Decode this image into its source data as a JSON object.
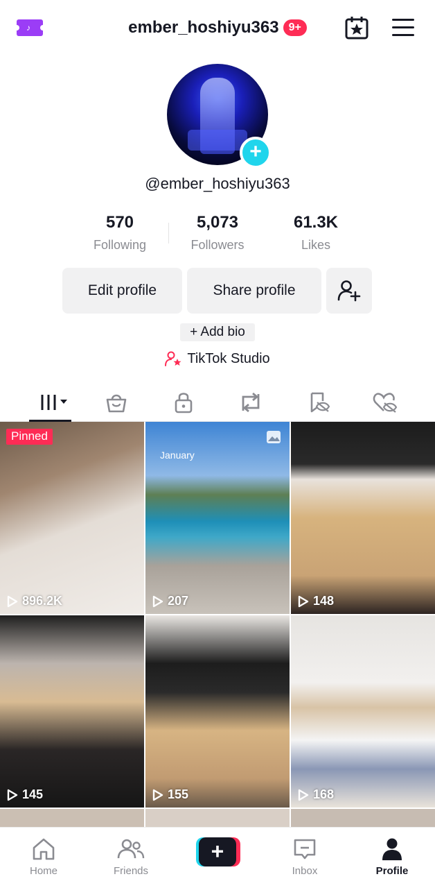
{
  "header": {
    "username": "ember_hoshiyu363",
    "notification_badge": "9+",
    "icons": [
      "tiktok-coin-ticket-icon",
      "calendar-star-icon",
      "hamburger-menu-icon"
    ]
  },
  "profile": {
    "handle": "@ember_hoshiyu363",
    "add_avatar_symbol": "+"
  },
  "stats": [
    {
      "value": "570",
      "label": "Following"
    },
    {
      "value": "5,073",
      "label": "Followers"
    },
    {
      "value": "61.3K",
      "label": "Likes"
    }
  ],
  "actions": {
    "edit_profile": "Edit profile",
    "share_profile": "Share profile",
    "add_bio": "+ Add bio",
    "studio": "TikTok Studio"
  },
  "tabs": [
    "videos",
    "shop",
    "private",
    "reposts",
    "favorites-hidden",
    "liked-hidden"
  ],
  "videos": [
    {
      "views": "896.2K",
      "pinned": "Pinned"
    },
    {
      "views": "207",
      "caption": "January",
      "photo": true
    },
    {
      "views": "148"
    },
    {
      "views": "145"
    },
    {
      "views": "155"
    },
    {
      "views": "168"
    }
  ],
  "nav": {
    "home": "Home",
    "friends": "Friends",
    "create": "+",
    "inbox": "Inbox",
    "profile": "Profile"
  },
  "colors": {
    "accent_red": "#fe2c55",
    "accent_cyan": "#20d5ec",
    "ticket_purple": "#9b3df6",
    "text": "#161823",
    "muted": "#8a8b91"
  }
}
